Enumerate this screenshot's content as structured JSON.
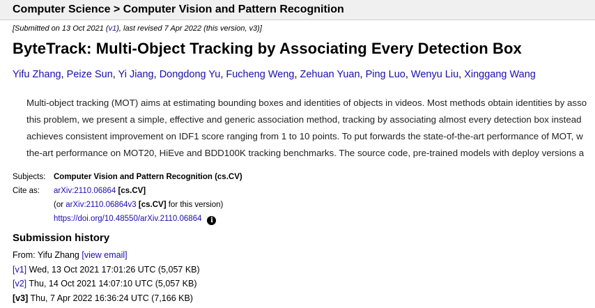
{
  "breadcrumb": "Computer Science > Computer Vision and Pattern Recognition",
  "dateline": {
    "prefix": "[Submitted on 13 Oct 2021 (",
    "v1_link": "v1",
    "suffix": "), last revised 7 Apr 2022 (this version, v3)]"
  },
  "title": "ByteTrack: Multi-Object Tracking by Associating Every Detection Box",
  "authors": [
    "Yifu Zhang",
    "Peize Sun",
    "Yi Jiang",
    "Dongdong Yu",
    "Fucheng Weng",
    "Zehuan Yuan",
    "Ping Luo",
    "Wenyu Liu",
    "Xinggang Wang"
  ],
  "abstract_lines": [
    "Multi-object tracking (MOT) aims at estimating bounding boxes and identities of objects in videos. Most methods obtain identities by asso",
    "this problem, we present a simple, effective and generic association method, tracking by associating almost every detection box instead",
    "achieves consistent improvement on IDF1 score ranging from 1 to 10 points. To put forwards the state-of-the-art performance of MOT, w",
    "the-art performance on MOT20, HiEve and BDD100K tracking benchmarks. The source code, pre-trained models with deploy versions a"
  ],
  "meta": {
    "subjects_label": "Subjects:",
    "subjects_value": "Computer Vision and Pattern Recognition (cs.CV)",
    "cite_label": "Cite as:",
    "cite_link": "arXiv:2110.06864",
    "cite_tag": "[cs.CV]",
    "or_prefix": "(or ",
    "version_link": "arXiv:2110.06864v3",
    "version_tag": "[cs.CV]",
    "version_suffix": " for this version)",
    "doi_link": "https://doi.org/10.48550/arXiv.2110.06864"
  },
  "history": {
    "title": "Submission history",
    "from_prefix": "From: Yifu Zhang ",
    "view_email": "[view email]",
    "versions": [
      {
        "label": "[v1]",
        "date": " Wed, 13 Oct 2021 17:01:26 UTC (5,057 KB)",
        "link": true
      },
      {
        "label": "[v2]",
        "date": " Thu, 14 Oct 2021 14:07:10 UTC (5,057 KB)",
        "link": true
      },
      {
        "label": "[v3]",
        "date": " Thu, 7 Apr 2022 16:36:24 UTC (7,166 KB)",
        "link": false
      }
    ]
  },
  "icons": {
    "info": "info-icon"
  }
}
